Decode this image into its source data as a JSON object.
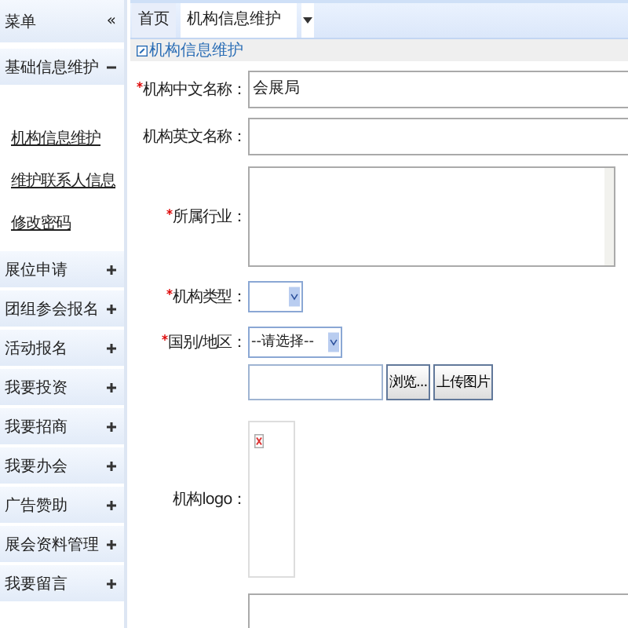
{
  "sidebar": {
    "title": "菜单",
    "collapse_icon": "«",
    "sections": [
      {
        "label": "基础信息维护",
        "expanded": true,
        "items": [
          {
            "label": "机构信息维护"
          },
          {
            "label": "维护联系人信息"
          },
          {
            "label": "修改密码"
          }
        ]
      },
      {
        "label": "展位申请",
        "expanded": false
      },
      {
        "label": "团组参会报名",
        "expanded": false
      },
      {
        "label": "活动报名",
        "expanded": false
      },
      {
        "label": "我要投资",
        "expanded": false
      },
      {
        "label": "我要招商",
        "expanded": false
      },
      {
        "label": "我要办会",
        "expanded": false
      },
      {
        "label": "广告赞助",
        "expanded": false
      },
      {
        "label": "展会资料管理",
        "expanded": false
      },
      {
        "label": "我要留言",
        "expanded": false
      }
    ]
  },
  "tabs": [
    {
      "label": "首页",
      "selected": false
    },
    {
      "label": "机构信息维护",
      "selected": true
    }
  ],
  "form": {
    "title": "机构信息维护",
    "fields": [
      {
        "kind": "text",
        "label": "机构中文名称：",
        "required": true,
        "value": "会展局"
      },
      {
        "kind": "text",
        "label": "机构英文名称：",
        "required": false
      },
      {
        "kind": "textarea",
        "label": "所属行业：",
        "required": true
      },
      {
        "kind": "select",
        "label": "机构类型：",
        "required": true
      },
      {
        "kind": "select",
        "label": "国别/地区：",
        "required": true,
        "value": "--请选择--"
      },
      {
        "kind": "file",
        "browse": "浏览...",
        "upload": "上传图片"
      },
      {
        "kind": "image",
        "label": "机构logo：",
        "required": false
      },
      {
        "kind": "text"
      }
    ]
  }
}
